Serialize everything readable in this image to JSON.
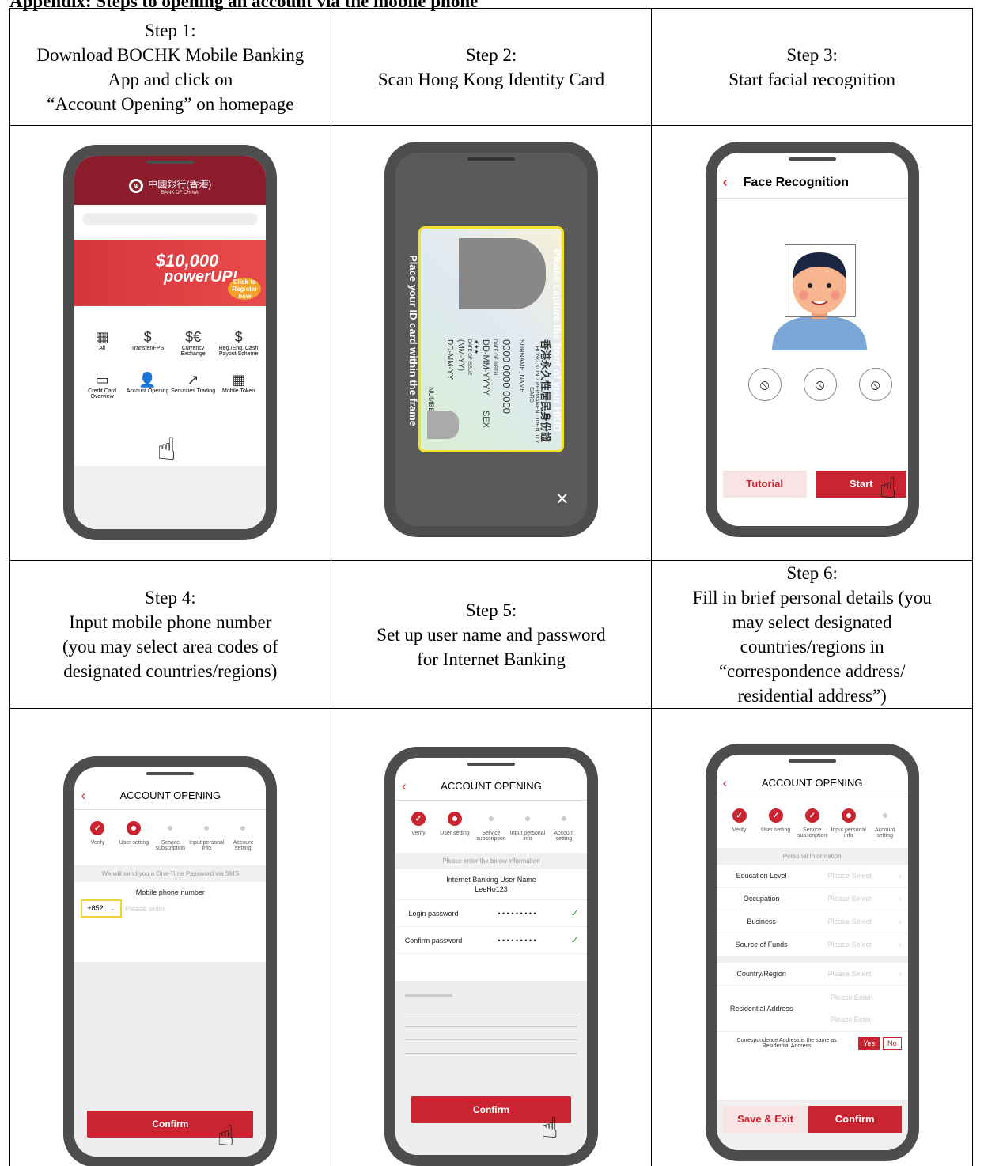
{
  "heading": "Appendix: Steps to opening an account via the mobile phone",
  "steps": [
    {
      "lines": [
        "Step 1:",
        "Download BOCHK Mobile Banking",
        "App and click on",
        "“Account Opening” on homepage"
      ]
    },
    {
      "lines": [
        "Step 2:",
        "Scan Hong Kong Identity Card"
      ]
    },
    {
      "lines": [
        "Step 3:",
        "Start facial recognition"
      ]
    },
    {
      "lines": [
        "Step 4:",
        "Input mobile phone number",
        "(you may select area codes of",
        "designated countries/regions)"
      ]
    },
    {
      "lines": [
        "Step 5:",
        "Set up user name and password",
        "for Internet Banking"
      ]
    },
    {
      "lines": [
        "Step 6:",
        "Fill in brief personal details (you",
        "may select designated",
        "countries/regions in",
        "“correspondence address/",
        "residential address”)"
      ]
    }
  ],
  "s1": {
    "bank": "中國銀行(香港)",
    "bank_en": "BANK OF CHINA",
    "promo1": "$10,000",
    "promo2": "powerUP!",
    "promo_cta": "Click to Register now",
    "icons": [
      {
        "icon": "▦",
        "label": "All"
      },
      {
        "icon": "$",
        "label": "Transfer/FPS"
      },
      {
        "icon": "$€",
        "label": "Currency Exchange"
      },
      {
        "icon": "$",
        "label": "Reg./Enq. Cash Payout Scheme"
      },
      {
        "icon": "▭",
        "label": "Credit Card Overview"
      },
      {
        "icon": "👤",
        "label": "Account Opening"
      },
      {
        "icon": "↗",
        "label": "Securities Trading"
      },
      {
        "icon": "▦",
        "label": "Mobile Token"
      }
    ]
  },
  "s2": {
    "right_text": "Please capture the front of your HKID",
    "left_text": "Place your ID card within the frame",
    "card_title_cn": "香港永久性居民身份證",
    "card_title_en": "HONG KONG PERMANENT IDENTITY CARD",
    "surname": "SURNAME, NAME",
    "code": "0000 0000 0000",
    "dob_label": "DATE OF BIRTH",
    "dob": "DD-MM-YYYY",
    "sex": "SEX",
    "stars": "★★★",
    "issue_label": "DATE OF ISSUE",
    "issue": "(MM-YY)",
    "issue2": "DD-MM-YY",
    "numbers": "NUMBERS",
    "close": "×"
  },
  "s3": {
    "title": "Face Recognition",
    "back": "‹",
    "tutorial": "Tutorial",
    "start": "Start"
  },
  "s4": {
    "title": "ACCOUNT OPENING",
    "back": "‹",
    "progress": [
      "Verify",
      "User setting",
      "Service subscription",
      "Input personal info",
      "Account setting"
    ],
    "notice": "We will send you a One-Time Password via SMS",
    "field_label": "Mobile phone number",
    "area_code": "+852",
    "placeholder": "Please enter",
    "confirm": "Confirm"
  },
  "s5": {
    "title": "ACCOUNT OPENING",
    "back": "‹",
    "notice": "Please enter the below information",
    "user_label": "Internet Banking User Name",
    "user_value": "LeeHo123",
    "login_label": "Login password",
    "confirm_label": "Confirm password",
    "dots": "• • • • • • • • •",
    "check": "✓",
    "confirm": "Confirm"
  },
  "s6": {
    "title": "ACCOUNT OPENING",
    "back": "‹",
    "section": "Personal Information",
    "rows": [
      {
        "k": "Education Level",
        "v": "Please Select"
      },
      {
        "k": "Occupation",
        "v": "Please Select"
      },
      {
        "k": "Business",
        "v": "Please Select"
      },
      {
        "k": "Source of Funds",
        "v": "Please Select"
      }
    ],
    "country_label": "Country/Region",
    "country_value": "Please Select",
    "res_label": "Residential Address",
    "enter": "Please Enter",
    "corr_text": "Correspondence Address is the same as Residential Address",
    "yes": "Yes",
    "no": "No",
    "save": "Save & Exit",
    "confirm": "Confirm"
  },
  "colors": {
    "accent": "#c9242f",
    "bank_red": "#8b1d2c",
    "frame": "#4d4d4d"
  }
}
